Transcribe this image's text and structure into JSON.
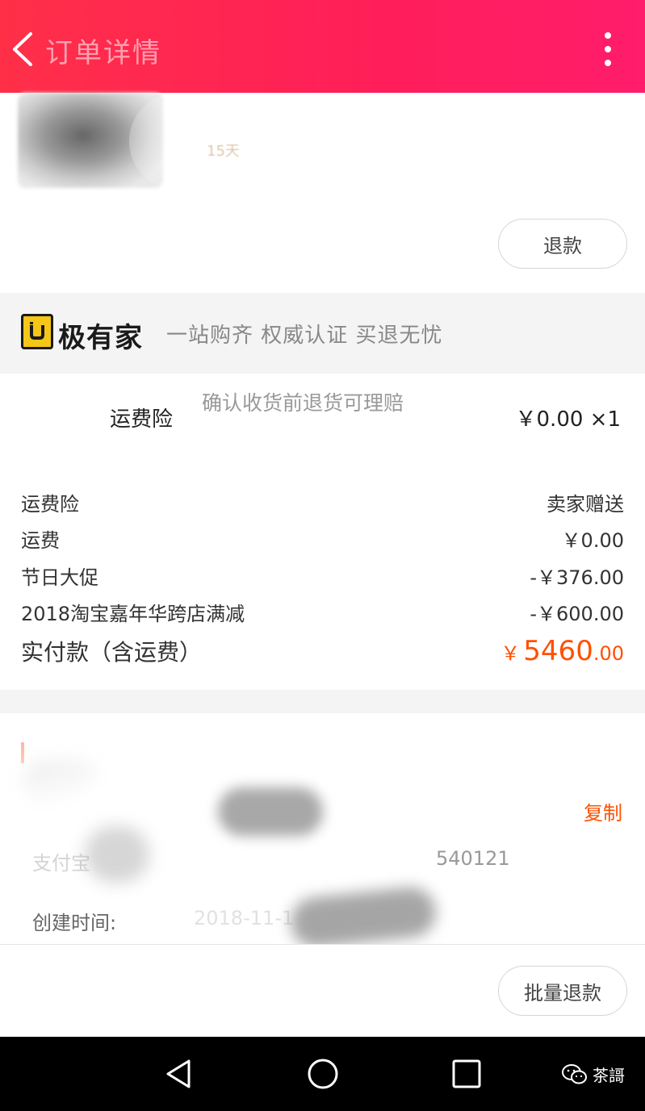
{
  "header": {
    "title": "订单详情",
    "back_icon": "chevron-left-icon",
    "more_icon": "more-vertical-icon"
  },
  "product": {
    "faint_text": "15天",
    "refund_label": "退款"
  },
  "brand": {
    "name": "极有家",
    "slogan": "一站购齐 权威认证 买退无忧",
    "logo_color": "#f5c518"
  },
  "insurance": {
    "name": "运费险",
    "description": "确认收货前退货可理赔",
    "price": "￥0.00 ×1"
  },
  "summary": {
    "rows": [
      {
        "label": "运费险",
        "value": "卖家赠送"
      },
      {
        "label": "运费",
        "value": "￥0.00"
      },
      {
        "label": "节日大促",
        "value": "-￥376.00"
      },
      {
        "label": "2018淘宝嘉年华跨店满减",
        "value": "-￥600.00"
      }
    ],
    "total_label": "实付款（含运费）",
    "total_currency": "￥",
    "total_integer": "5460",
    "total_decimal": ".00",
    "accent_color": "#ff5000"
  },
  "order_info": {
    "copy_label": "复制",
    "pay_label": "支付宝",
    "pay_value_partial": "540121",
    "create_label": "创建时间:",
    "create_value_partial": "2018-11-1"
  },
  "footer": {
    "batch_refund_label": "批量退款"
  },
  "system_nav": {
    "back_icon": "nav-back-icon",
    "home_icon": "nav-home-icon",
    "recent_icon": "nav-recent-icon",
    "watermark_icon": "wechat-icon",
    "watermark_text": "茶謌"
  }
}
